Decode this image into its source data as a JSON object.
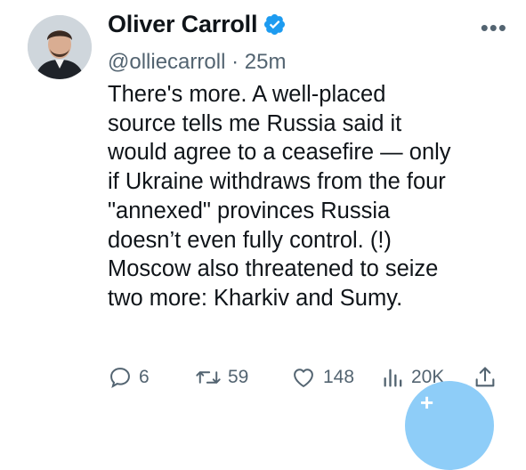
{
  "author": {
    "name": "Oliver Carroll",
    "handle": "@olliecarroll",
    "separator": "·",
    "time": "25m"
  },
  "tweet": {
    "text": "There's more. A well-placed\nsource tells me Russia said it\nwould agree to a ceasefire — only\nif Ukraine withdraws from the four\n\"annexed\" provinces Russia\ndoesn’t even fully control. (!)\nMoscow also threatened to seize\ntwo more: Kharkiv and Sumy."
  },
  "actions": {
    "replies": "6",
    "reposts": "59",
    "likes": "148",
    "views": "20K"
  },
  "icons": {
    "verified": "verified-badge-icon",
    "more": "more-options-icon",
    "reply": "reply-icon",
    "repost": "repost-icon",
    "like": "heart-icon",
    "views": "analytics-icon",
    "share": "share-icon",
    "compose": "compose-fab-icon"
  },
  "colors": {
    "verified": "#1d9bf0",
    "secondary_text": "#536471",
    "fab": "#8ecdf8"
  }
}
